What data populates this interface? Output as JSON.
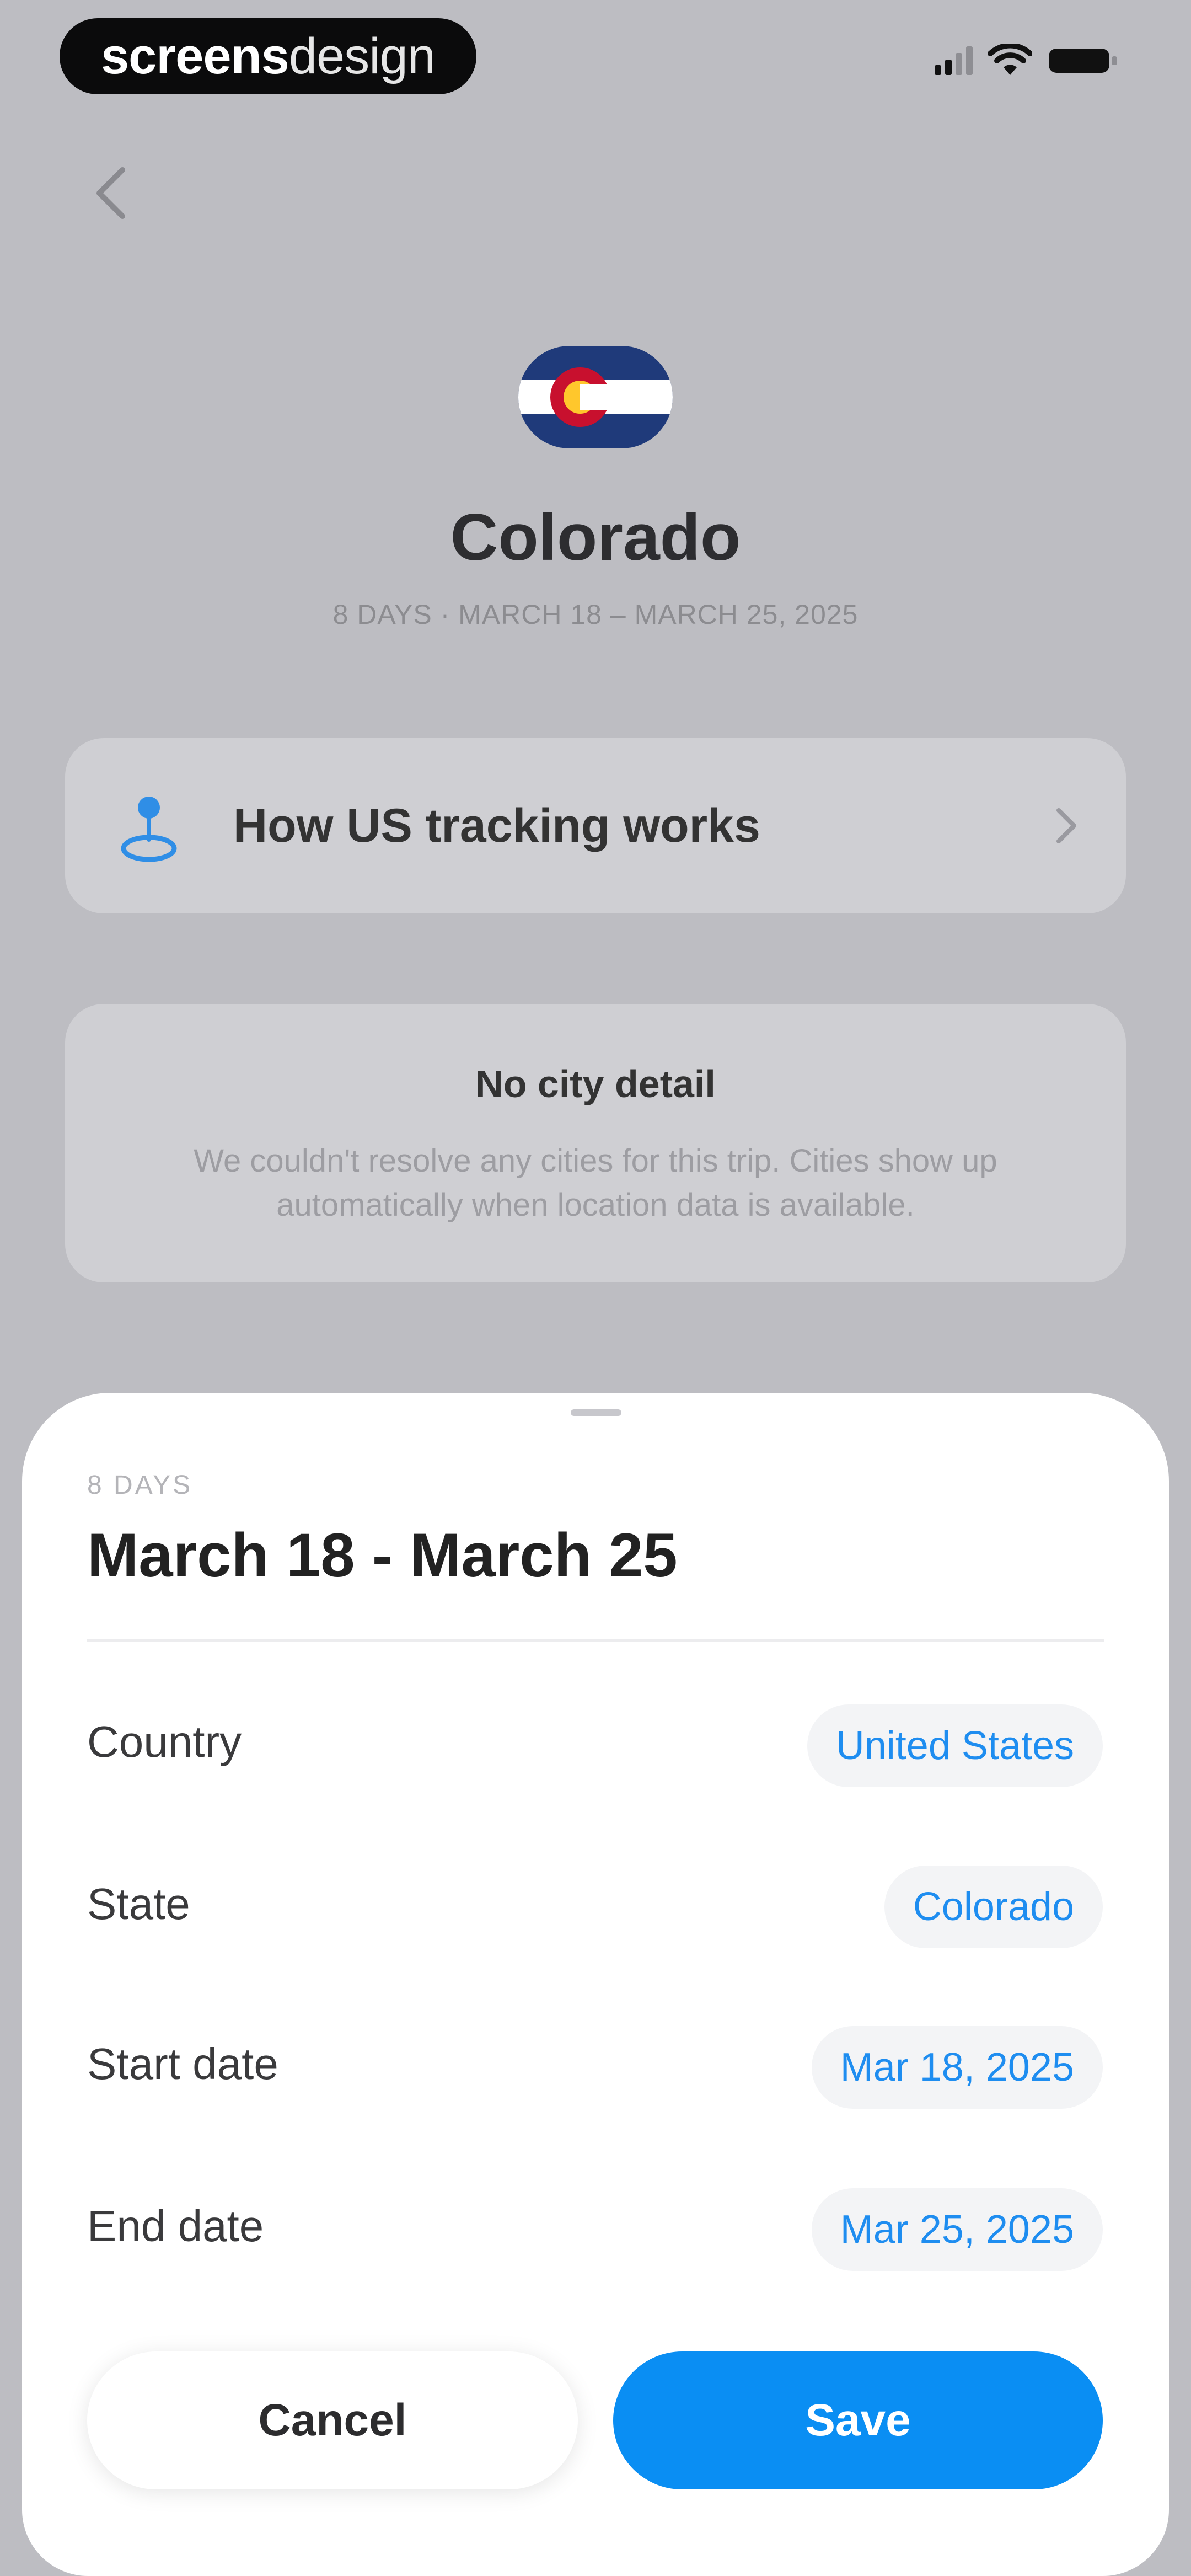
{
  "status_bar": {
    "brand_bold": "screens",
    "brand_light": "design"
  },
  "header": {
    "title": "Colorado",
    "subtitle": "8 DAYS · MARCH 18 – MARCH 25, 2025"
  },
  "info_card": {
    "label": "How US tracking works"
  },
  "empty_state": {
    "title": "No city detail",
    "body": "We couldn't resolve any cities for this trip. Cities show up automatically when location data is available."
  },
  "sheet": {
    "kicker": "8 DAYS",
    "title": "March 18 - March 25",
    "rows": [
      {
        "label": "Country",
        "value": "United States"
      },
      {
        "label": "State",
        "value": "Colorado"
      },
      {
        "label": "Start date",
        "value": "Mar 18, 2025"
      },
      {
        "label": "End date",
        "value": "Mar 25, 2025"
      }
    ],
    "cancel_label": "Cancel",
    "save_label": "Save"
  },
  "colors": {
    "accent": "#0a8ef3",
    "link": "#1e8df0",
    "backdrop": "#bdbdc2"
  }
}
